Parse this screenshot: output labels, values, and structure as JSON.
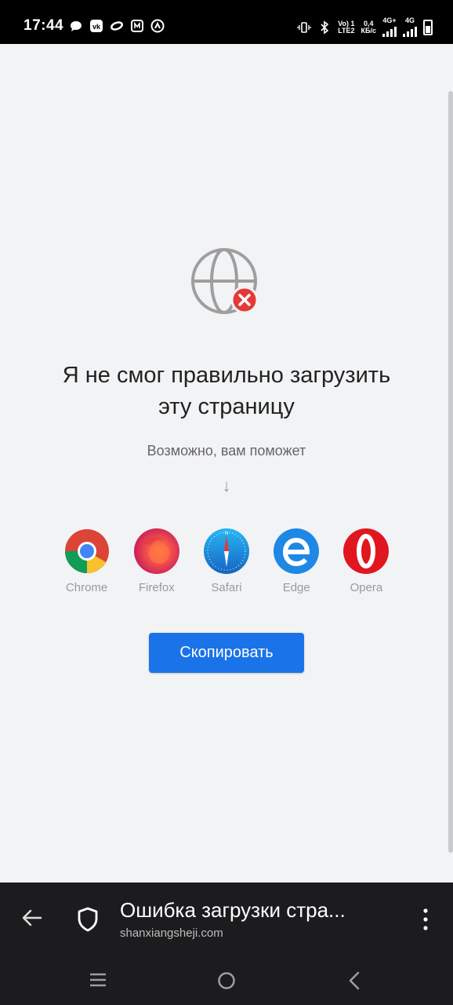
{
  "status_bar": {
    "time": "17:44",
    "left_icons": [
      "message-icon",
      "vk-icon",
      "infinity-icon",
      "news-icon",
      "speed-icon"
    ],
    "volte": "Vo) 1",
    "lte": "LTE2",
    "speed_value": "0,4",
    "speed_unit": "КБ/с",
    "net1": "4G+",
    "net2": "4G"
  },
  "error": {
    "title_line1": "Я не смог правильно загрузить",
    "title_line2": "эту страницу",
    "hint": "Возможно, вам поможет",
    "arrow": "↓"
  },
  "browsers": [
    {
      "name": "Chrome",
      "icon": "chrome-icon"
    },
    {
      "name": "Firefox",
      "icon": "firefox-icon"
    },
    {
      "name": "Safari",
      "icon": "safari-icon"
    },
    {
      "name": "Edge",
      "icon": "edge-icon"
    },
    {
      "name": "Opera",
      "icon": "opera-icon"
    }
  ],
  "copy_button": "Скопировать",
  "address_bar": {
    "title": "Ошибка загрузки стра...",
    "url": "shanxiangsheji.com"
  },
  "colors": {
    "accent": "#1a73e8",
    "error": "#e53935",
    "background": "#f2f3f5",
    "bar": "#1c1c1e"
  }
}
